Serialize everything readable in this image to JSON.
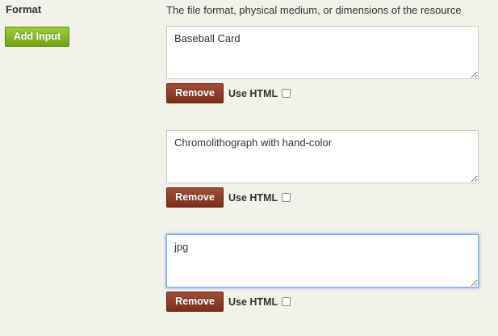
{
  "field": {
    "label": "Format",
    "add_button_label": "Add Input",
    "description": "The file format, physical medium, or dimensions of the resource"
  },
  "inputs": [
    {
      "value": "Baseball Card",
      "remove_label": "Remove",
      "use_html_label": "Use HTML",
      "use_html_checked": false,
      "focused": false
    },
    {
      "value": "Chromolithograph with hand-color",
      "remove_label": "Remove",
      "use_html_label": "Use HTML",
      "use_html_checked": false,
      "focused": false
    },
    {
      "value": "jpg",
      "remove_label": "Remove",
      "use_html_label": "Use HTML",
      "use_html_checked": false,
      "focused": true
    }
  ],
  "colors": {
    "add_button": "#7fb224",
    "remove_button": "#8b3a25",
    "focus_ring": "#7aa7e6",
    "background": "#f2f1ea"
  }
}
